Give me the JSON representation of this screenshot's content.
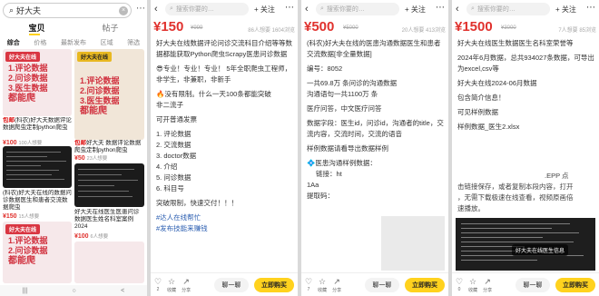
{
  "panel1": {
    "search_text": "好大夫",
    "tabs": [
      "宝贝",
      "帖子"
    ],
    "sorts": [
      "综合",
      "价格",
      "最新发布",
      "区域",
      "筛选"
    ],
    "cards": [
      {
        "badge": "好大夫在线",
        "lines": [
          "1.评论数据",
          "2.问诊数据",
          "3.医生数据"
        ],
        "big": "都能爬",
        "title_hl": "包邮",
        "title": "(科农)好大夫数据评论数据爬虫定制python爬虫",
        "price": "¥100",
        "meta": "100人想要"
      },
      {
        "badge": "好大夫在线",
        "lines": [
          "1.评论数据",
          "2.问诊数据",
          "3.医生数据"
        ],
        "big": "都能爬",
        "title_hl": "包邮",
        "title": "好大夫 数据评论数据爬虫定制python爬虫requests",
        "price": "¥50",
        "meta": "23人想要"
      },
      {
        "title": "(科农)好大夫在线的数据问诊数据医生和患者交流数据爬虫",
        "price": "¥150",
        "meta": "15人想要"
      },
      {
        "title": "好大夫在线医生医患问诊数据医生姓名科室案例 2024",
        "price": "¥100",
        "meta": "6人想要"
      },
      {
        "badge": "好大夫在线",
        "lines": [
          "1.评论数据",
          "2.问诊数据"
        ],
        "big": "都能爬"
      }
    ],
    "bottom": [
      "|||",
      "○",
      "<"
    ]
  },
  "panel2": {
    "price": "¥150",
    "old": "¥999",
    "stats": "86人想要  1604浏览",
    "search_placeholder": "搜索你要的…",
    "follow": "+ 关注",
    "paragraphs": [
      "好大夫在线数据评论问诊交流科目介绍等等数据都能获取Python爬虫Scrapy医患问诊数据",
      "😎专业！专业！专业！ 5年全职爬虫工程师，非学生，非兼职，非新手",
      "🔥没有限制。什么一天100条都能突破",
      "非二流子",
      "可开普通发票",
      "1. 评论数据",
      "2. 交流数据",
      "3. doctor数据",
      "4. 介绍",
      "5. 问诊数据",
      "6. 科目号",
      "突破限制，快速交付！！！"
    ],
    "tags": [
      "#达人在线帮忙",
      "#发布技能来赚钱"
    ],
    "footer": {
      "like": "2",
      "star": "收藏",
      "share": "分享",
      "chat": "聊一聊",
      "buy": "立即购买"
    }
  },
  "panel3": {
    "price": "¥500",
    "old": "¥5000",
    "stats": "20人想要  413浏览",
    "search_placeholder": "搜索你要的…",
    "follow": "+ 关注",
    "paragraphs": [
      "(科农)好大夫在线的医患沟通数据医生和患者交流数据[非全量数据]",
      "编号：8052",
      "一共69.8万 条问诊的沟通数据",
      "沟通语句一共1100万 条",
      "医疗问答，中文医疗问答",
      "数据字段：医生id，问诊id，沟通者的title，交流内容，交流时间，交流的语音",
      "样例数据请看导出数据样例",
      "💠医患沟通样例数据："
    ],
    "link_label": "链接：",
    "link_value": "ht",
    "code_label": "1Aa",
    "extract": "提取码：",
    "footer": {
      "like": "7",
      "star": "收藏",
      "share": "分享",
      "chat": "聊一聊",
      "buy": "立即购买"
    }
  },
  "panel4": {
    "price": "¥1500",
    "old": "¥3000",
    "stats": "7人想要  85浏览",
    "search_placeholder": "搜索你要的…",
    "follow": "+ 关注",
    "paragraphs": [
      "好大夫在线医生数据医生名科室荣誉等",
      "2024年6月数据，总共934027条数据，可导出为excel,csv等",
      "好大夫在线2024-06月数据",
      "包含简介信息！",
      "可见样例数据",
      "样例数据_医生2.xlsx"
    ],
    "overlay_lines": [
      ".EPP 点",
      "击链接保存，或者复制本段内容，打开",
      "，无需下载极速在线查看，视频原画倍",
      "速播放。"
    ],
    "toast": "好大夫在线医生信息",
    "footer": {
      "like": "0",
      "star": "收藏",
      "share": "分享",
      "chat": "聊一聊",
      "buy": "立即购买"
    }
  },
  "colors": {
    "price": "#e0312d",
    "buy": "#ffd21e",
    "tag": "#d93642"
  }
}
